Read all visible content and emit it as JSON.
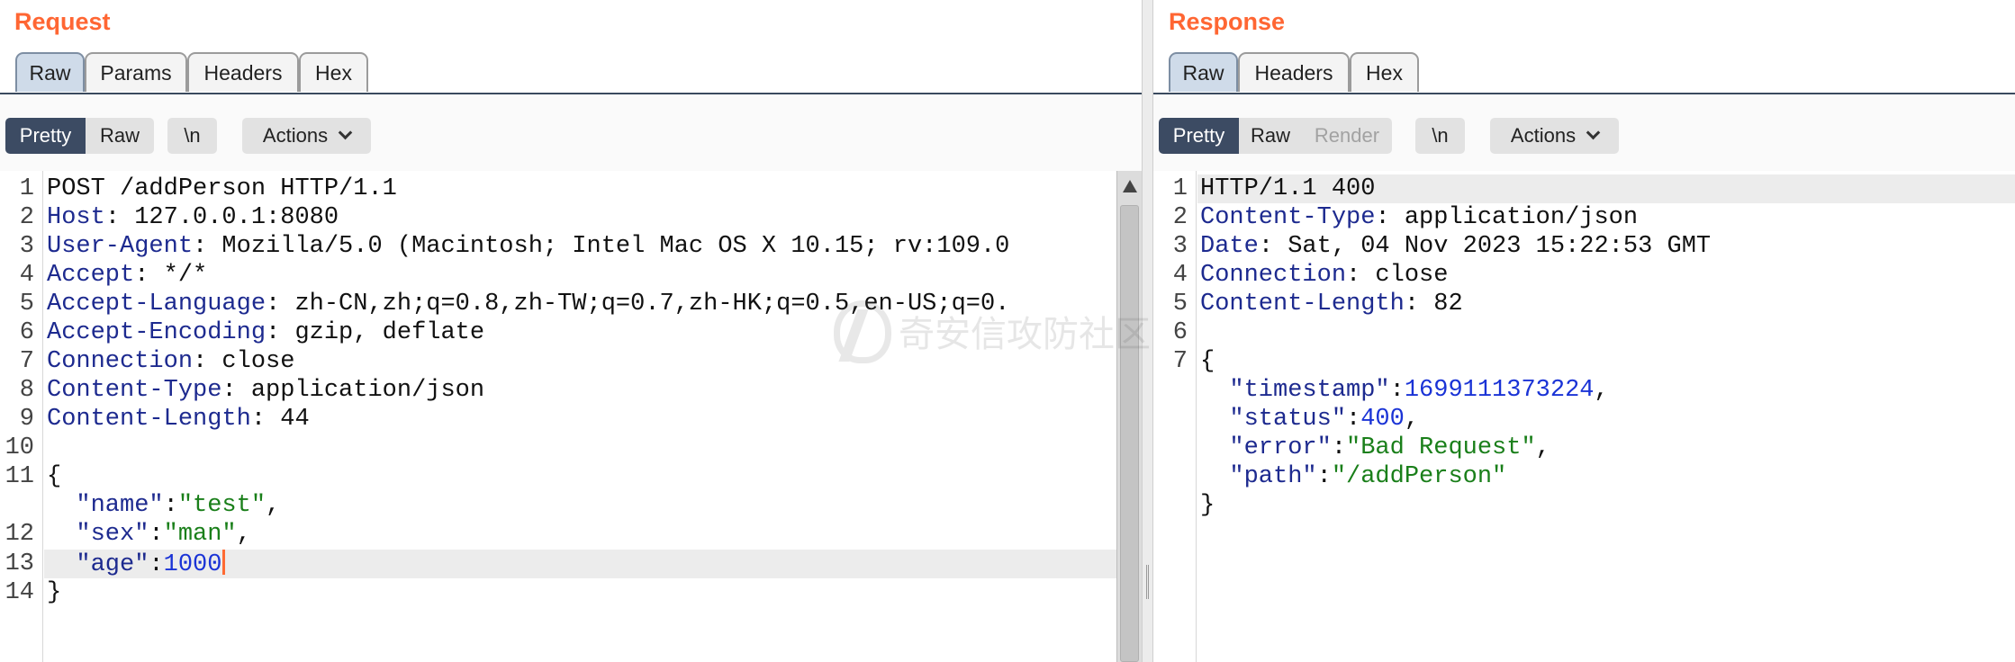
{
  "request": {
    "title": "Request",
    "tabs": [
      "Raw",
      "Params",
      "Headers",
      "Hex"
    ],
    "view_modes": [
      "Pretty",
      "Raw"
    ],
    "newline_toggle": "\\n",
    "actions_label": "Actions",
    "lines": [
      {
        "n": "1",
        "key": "",
        "rest": "POST /addPerson HTTP/1.1"
      },
      {
        "n": "2",
        "key": "Host",
        "rest": ": 127.0.0.1:8080"
      },
      {
        "n": "3",
        "key": "User-Agent",
        "rest": ": Mozilla/5.0 (Macintosh; Intel Mac OS X 10.15; rv:109.0"
      },
      {
        "n": "4",
        "key": "Accept",
        "rest": ": */*"
      },
      {
        "n": "5",
        "key": "Accept-Language",
        "rest": ": zh-CN,zh;q=0.8,zh-TW;q=0.7,zh-HK;q=0.5,en-US;q=0."
      },
      {
        "n": "6",
        "key": "Accept-Encoding",
        "rest": ": gzip, deflate"
      },
      {
        "n": "7",
        "key": "Connection",
        "rest": ": close"
      },
      {
        "n": "8",
        "key": "Content-Type",
        "rest": ": application/json"
      },
      {
        "n": "9",
        "key": "Content-Length",
        "rest": ": 44"
      },
      {
        "n": "10"
      },
      {
        "n": "11",
        "open": "{"
      },
      {
        "jkey": "\"name\"",
        "sep": ":",
        "sval": "\"test\"",
        "end": ","
      },
      {
        "n": "12",
        "jkey": "\"sex\"",
        "sep": ":",
        "sval": "\"man\"",
        "end": ","
      },
      {
        "n": "13",
        "jkey": "\"age\"",
        "sep": ":",
        "nval": "1000"
      },
      {
        "n": "14",
        "close": "}"
      }
    ]
  },
  "response": {
    "title": "Response",
    "tabs": [
      "Raw",
      "Headers",
      "Hex"
    ],
    "view_modes": [
      "Pretty",
      "Raw",
      "Render"
    ],
    "newline_toggle": "\\n",
    "actions_label": "Actions",
    "lines": [
      {
        "n": "1",
        "key": "",
        "rest": "HTTP/1.1 400"
      },
      {
        "n": "2",
        "key": "Content-Type",
        "rest": ": application/json"
      },
      {
        "n": "3",
        "key": "Date",
        "rest": ": Sat, 04 Nov 2023 15:22:53 GMT"
      },
      {
        "n": "4",
        "key": "Connection",
        "rest": ": close"
      },
      {
        "n": "5",
        "key": "Content-Length",
        "rest": ": 82"
      },
      {
        "n": "6"
      },
      {
        "n": "7",
        "open": "{"
      },
      {
        "jkey": "\"timestamp\"",
        "sep": ":",
        "nval": "1699111373224",
        "end": ","
      },
      {
        "jkey": "\"status\"",
        "sep": ":",
        "nval": "400",
        "end": ","
      },
      {
        "jkey": "\"error\"",
        "sep": ":",
        "sval": "\"Bad Request\"",
        "end": ","
      },
      {
        "jkey": "\"path\"",
        "sep": ":",
        "sval": "\"/addPerson\""
      },
      {
        "close": "}"
      }
    ]
  },
  "watermark": "奇安信攻防社区"
}
